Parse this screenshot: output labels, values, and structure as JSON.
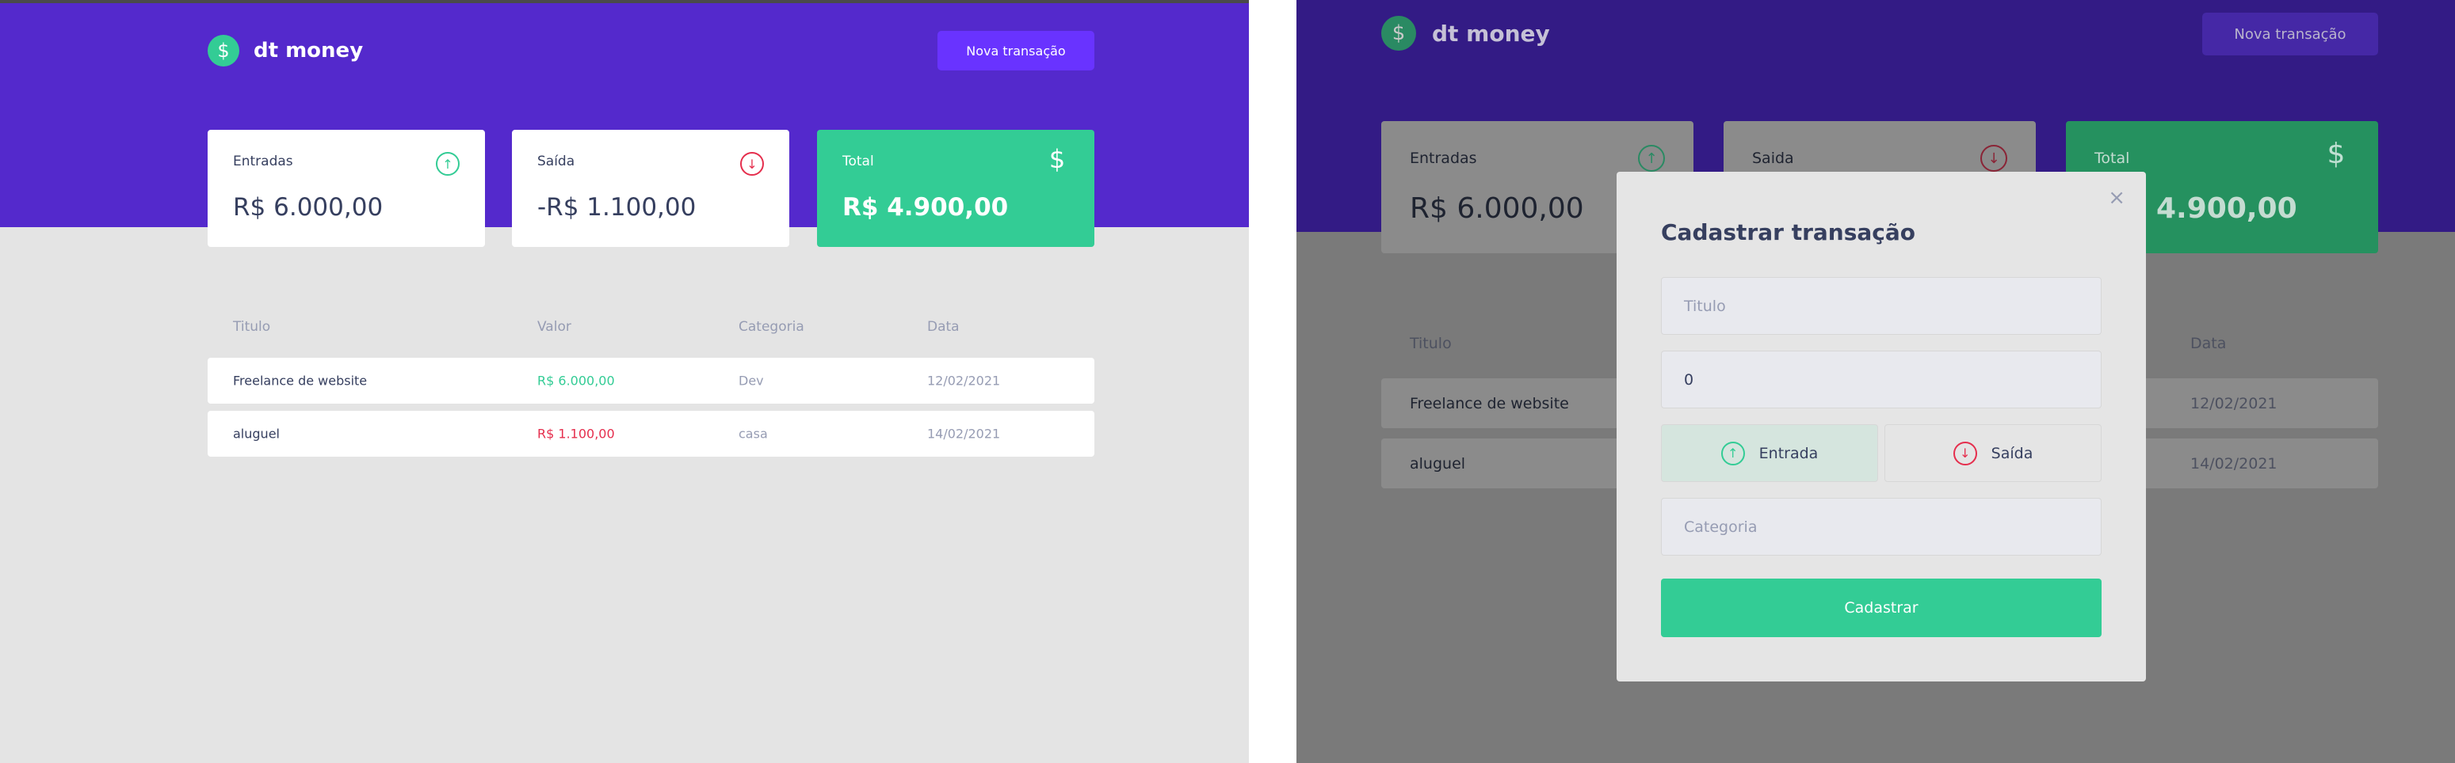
{
  "app": {
    "brand": "dt money",
    "new_transaction_label": "Nova transação"
  },
  "summary": {
    "income": {
      "label": "Entradas",
      "value": "R$ 6.000,00",
      "icon": "arrow-up-circle-icon"
    },
    "outcome": {
      "label": "Saída",
      "value": "-R$ 1.100,00",
      "icon": "arrow-down-circle-icon"
    },
    "total": {
      "label": "Total",
      "value": "R$ 4.900,00",
      "icon": "dollar-icon"
    }
  },
  "summary_dimmed": {
    "income": {
      "label": "Entradas",
      "value": "R$ 6.000,00"
    },
    "outcome": {
      "label": "Saida"
    },
    "total": {
      "label": "Total",
      "value_partial": "4.900,00"
    }
  },
  "table": {
    "headers": [
      "Titulo",
      "Valor",
      "Categoria",
      "Data"
    ],
    "rows": [
      {
        "title": "Freelance de website",
        "amount": "R$ 6.000,00",
        "type": "deposit",
        "category": "Dev",
        "date": "12/02/2021"
      },
      {
        "title": "aluguel",
        "amount": "R$ 1.100,00",
        "type": "withdraw",
        "category": "casa",
        "date": "14/02/2021"
      }
    ]
  },
  "modal": {
    "title": "Cadastrar transação",
    "close_symbol": "×",
    "title_placeholder": "Titulo",
    "amount_value": "0",
    "type_income_label": "Entrada",
    "type_outcome_label": "Saída",
    "category_placeholder": "Categoria",
    "submit_label": "Cadastrar"
  },
  "colors": {
    "primary": "#5429cc",
    "accent": "#6933ff",
    "green": "#33cc95",
    "red": "#e52e4d",
    "text_title": "#363f5f",
    "text_body": "#969cb3",
    "background": "#e4e4e4"
  }
}
